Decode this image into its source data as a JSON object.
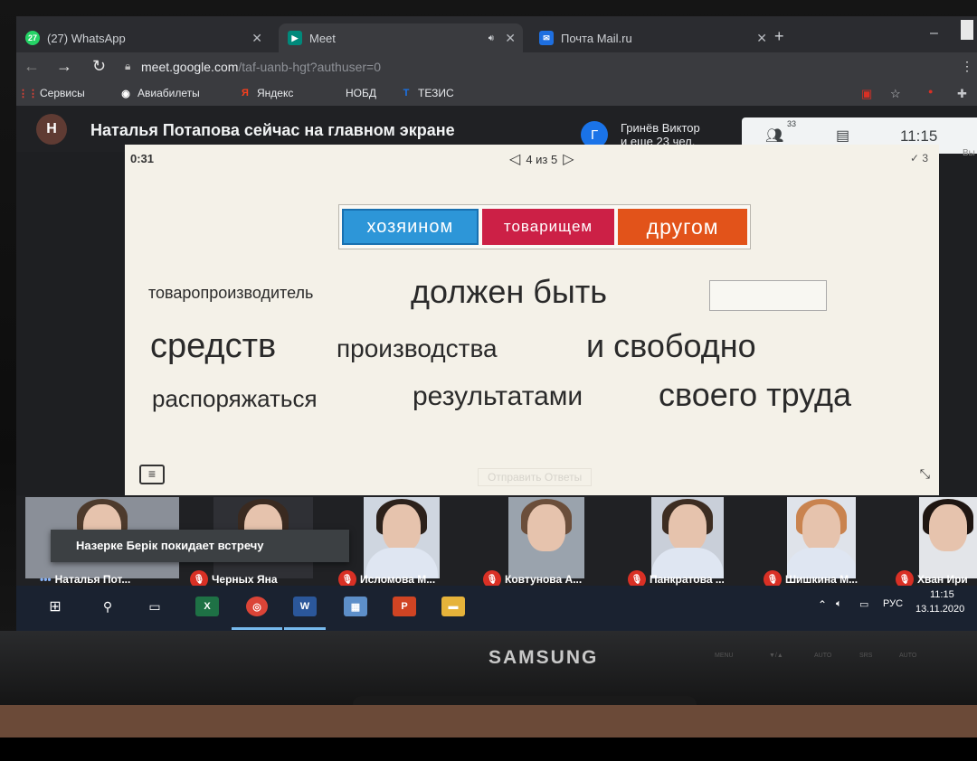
{
  "browser": {
    "tabs": [
      {
        "label": "(27) WhatsApp",
        "badge": "27",
        "icon": "whatsapp-icon",
        "color": "#25d366"
      },
      {
        "label": "Meet",
        "icon": "meet-icon",
        "color": "#00897b"
      },
      {
        "label": "Почта Mail.ru",
        "icon": "mail-icon",
        "color": "#1e6fe0"
      }
    ],
    "url_host": "meet.google.com",
    "url_path": "/taf-uanb-hgt?authuser=0",
    "bookmarks": [
      {
        "label": "Сервисы",
        "icon": "apps-grid-icon"
      },
      {
        "label": "Авиабилеты",
        "icon": "globe-icon"
      },
      {
        "label": "Яндекс",
        "icon": "yandex-icon"
      },
      {
        "label": "НОБД",
        "icon": ""
      },
      {
        "label": "ТЕЗИС",
        "icon": "tezis-icon"
      }
    ]
  },
  "meet": {
    "presenter_initial": "Н",
    "presenting_text": "Наталья Потапова сейчас на главном экране",
    "others_initial": "Г",
    "others_line1": "Гринёв Виктор",
    "others_line2": "и еще 23 чел.",
    "participants_count": "33",
    "clock": "11:15",
    "cut_text": "Вы"
  },
  "quiz": {
    "timer": "0:31",
    "pager": "4 из 5",
    "score": "✓ 3",
    "options": [
      "хозяином",
      "товарищем",
      "другом"
    ],
    "line1_small": "товаропроизводитель",
    "line1_big": "должен быть",
    "line2_a": "средств",
    "line2_b": "производства",
    "line2_c": "и свободно",
    "line3_a": "распоряжаться",
    "line3_b": "результатами",
    "line3_c": "своего труда",
    "submit": "Отправить Ответы"
  },
  "participants": [
    {
      "name": "Наталья Пот...",
      "muted": false
    },
    {
      "name": "Черных Яна",
      "muted": true
    },
    {
      "name": "Исломова М...",
      "muted": true
    },
    {
      "name": "Ковтунова А...",
      "muted": true
    },
    {
      "name": "Панкратова ...",
      "muted": true
    },
    {
      "name": "Шишкина М...",
      "muted": true
    },
    {
      "name": "Хван Ири",
      "muted": true
    }
  ],
  "toast": "Назерке Берік покидает встречу",
  "taskbar": {
    "lang": "РУС",
    "time": "11:15",
    "date": "13.11.2020"
  },
  "monitor_brand": "SAMSUNG",
  "monitor_buttons": [
    "MENU",
    "▼/▲",
    "AUTO",
    "SRS",
    "AUTO"
  ]
}
